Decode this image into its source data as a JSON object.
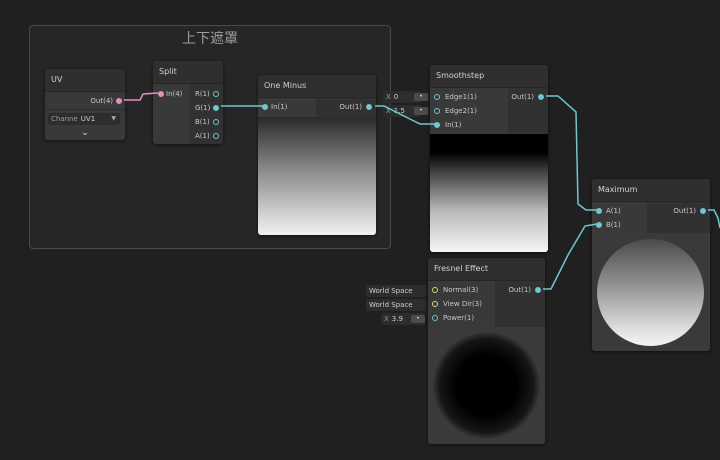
{
  "group": {
    "title": "上下遮罩"
  },
  "nodes": {
    "uv": {
      "title": "UV",
      "out": "Out(4)",
      "channel_label": "Channe",
      "channel_value": "UV1"
    },
    "split": {
      "title": "Split",
      "in": "In(4)",
      "outs": [
        "R(1)",
        "G(1)",
        "B(1)",
        "A(1)"
      ]
    },
    "one_minus": {
      "title": "One Minus",
      "in": "In(1)",
      "out": "Out(1)"
    },
    "smoothstep": {
      "title": "Smoothstep",
      "ins": [
        "Edge1(1)",
        "Edge2(1)",
        "In(1)"
      ],
      "out": "Out(1)",
      "edge1": {
        "axis": "X",
        "value": "0"
      },
      "edge2": {
        "axis": "X",
        "value": "1.5"
      }
    },
    "fresnel": {
      "title": "Fresnel Effect",
      "ins": [
        "Normal(3)",
        "View Dir(3)",
        "Power(1)"
      ],
      "out": "Out(1)",
      "normal_space": "World Space",
      "view_space": "World Space",
      "power": {
        "axis": "X",
        "value": "3.9"
      }
    },
    "maximum": {
      "title": "Maximum",
      "ins": [
        "A(1)",
        "B(1)"
      ],
      "out": "Out(1)"
    }
  },
  "colors": {
    "wire": "#6fc7d0",
    "wire_uv": "#e58ec1",
    "background": "#202020",
    "node": "#393939"
  }
}
